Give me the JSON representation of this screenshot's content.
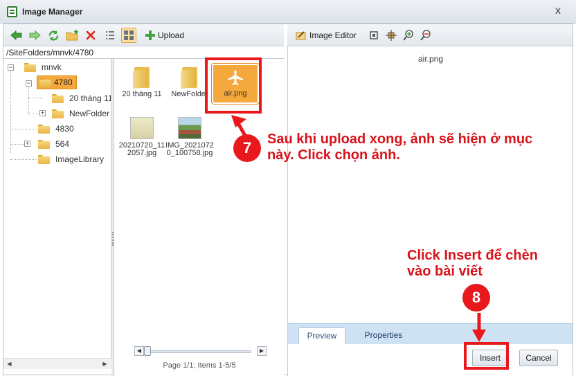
{
  "window": {
    "title": "Image Manager",
    "close_glyph": "x"
  },
  "toolbar_left": {
    "items": [
      {
        "name": "back-icon"
      },
      {
        "name": "forward-icon"
      },
      {
        "name": "refresh-icon"
      },
      {
        "name": "new-folder-icon"
      },
      {
        "name": "delete-icon"
      },
      {
        "name": "list-view-icon"
      },
      {
        "name": "thumbnail-view-icon",
        "active": true
      }
    ],
    "upload_label": "Upload"
  },
  "toolbar_right": {
    "image_editor_label": "Image Editor"
  },
  "path": "/SiteFolders/mnvk/4780",
  "tree": {
    "root": "mnvk",
    "nodes": [
      {
        "label": "4780",
        "selected": true
      },
      {
        "label": "20 tháng 11"
      },
      {
        "label": "NewFolder"
      },
      {
        "label": "4830"
      },
      {
        "label": "564"
      },
      {
        "label": "ImageLibrary"
      }
    ]
  },
  "files": [
    {
      "label": "20 tháng 11",
      "kind": "folder"
    },
    {
      "label": "NewFolder",
      "kind": "folder"
    },
    {
      "label": "air.png",
      "kind": "image",
      "selected": true
    },
    {
      "label": "20210720_112057.jpg",
      "kind": "photo"
    },
    {
      "label": "IMG_20210720_100758.jpg",
      "kind": "photo"
    }
  ],
  "pager": {
    "text": "Page 1/1; Items 1-5/5"
  },
  "preview": {
    "filename": "air.png"
  },
  "tabs": [
    {
      "label": "Preview",
      "active": true
    },
    {
      "label": "Properties"
    }
  ],
  "buttons": {
    "insert": "Insert",
    "cancel": "Cancel"
  },
  "annotations": {
    "step7_number": "7",
    "step7_text": "Sau khi upload xong, ảnh sẽ hiện ở mục này. Click chọn ảnh.",
    "step8_number": "8",
    "step8_text": "Click Insert để chèn vào bài viết"
  },
  "colors": {
    "annotation_red": "#e8181c",
    "selection_orange": "#f5a83c",
    "tab_bar_blue": "#cfe2f3"
  }
}
